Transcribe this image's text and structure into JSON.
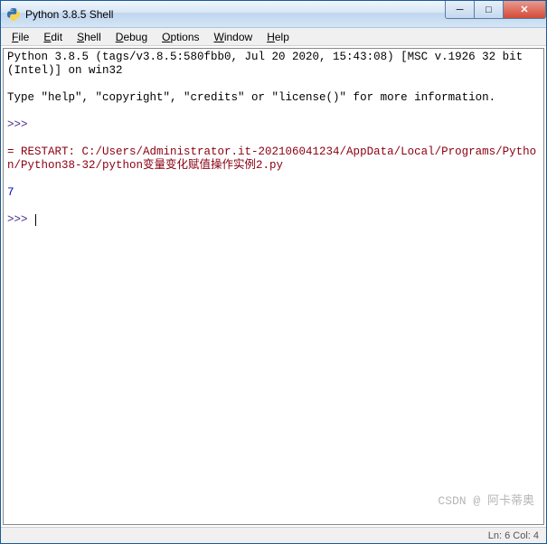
{
  "titlebar": {
    "title": "Python 3.8.5 Shell",
    "icon": "python-icon"
  },
  "win_controls": {
    "min": "─",
    "max": "□",
    "close": "✕"
  },
  "menubar": {
    "items": [
      {
        "label": "File",
        "ul": "F"
      },
      {
        "label": "Edit",
        "ul": "E"
      },
      {
        "label": "Shell",
        "ul": "S"
      },
      {
        "label": "Debug",
        "ul": "D"
      },
      {
        "label": "Options",
        "ul": "O"
      },
      {
        "label": "Window",
        "ul": "W"
      },
      {
        "label": "Help",
        "ul": "H"
      }
    ]
  },
  "shell": {
    "banner1": "Python 3.8.5 (tags/v3.8.5:580fbb0, Jul 20 2020, 15:43:08) [MSC v.1926 32 bit (Intel)] on win32",
    "banner2": "Type \"help\", \"copyright\", \"credits\" or \"license()\" for more information.",
    "prompt1": ">>> ",
    "restart": "= RESTART: C:/Users/Administrator.it-202106041234/AppData/Local/Programs/Python/Python38-32/python变量变化赋值操作实例2.py",
    "output": "7",
    "prompt2": ">>> "
  },
  "statusbar": {
    "text": "Ln: 6  Col: 4"
  },
  "watermark": "CSDN @ 阿卡蒂奥"
}
